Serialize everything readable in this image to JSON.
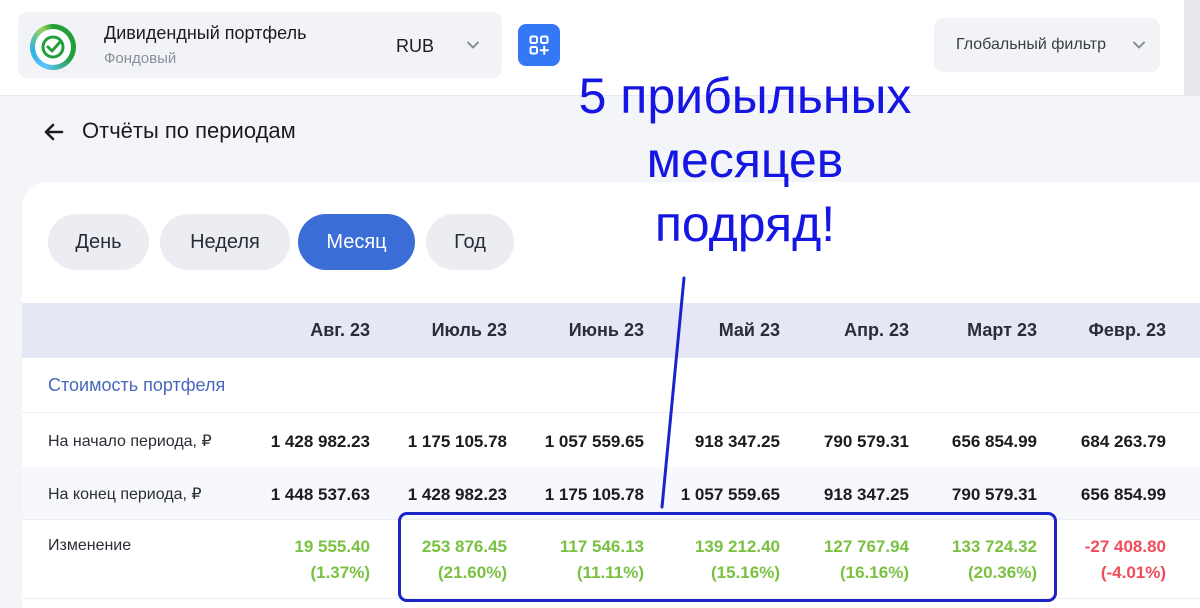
{
  "header": {
    "portfolio_name": "Дивидендный портфель",
    "portfolio_type": "Фондовый",
    "currency": "RUB",
    "global_filter": "Глобальный фильтр"
  },
  "page": {
    "title": "Отчёты по периодам"
  },
  "tabs": [
    {
      "label": "День",
      "active": false
    },
    {
      "label": "Неделя",
      "active": false
    },
    {
      "label": "Месяц",
      "active": true
    },
    {
      "label": "Год",
      "active": false
    }
  ],
  "table": {
    "columns": [
      "Авг. 23",
      "Июль 23",
      "Июнь 23",
      "Май 23",
      "Апр. 23",
      "Март 23",
      "Февр. 23"
    ],
    "section_label": "Стоимость портфеля",
    "rows": [
      {
        "label": "На начало периода, ₽",
        "values": [
          "1 428 982.23",
          "1 175 105.78",
          "1 057 559.65",
          "918 347.25",
          "790 579.31",
          "656 854.99",
          "684 263.79"
        ]
      },
      {
        "label": "На конец периода, ₽",
        "values": [
          "1 448 537.63",
          "1 428 982.23",
          "1 175 105.78",
          "1 057 559.65",
          "918 347.25",
          "790 579.31",
          "656 854.99"
        ]
      },
      {
        "label": "Изменение",
        "values": [
          "19 555.40",
          "253 876.45",
          "117 546.13",
          "139 212.40",
          "127 767.94",
          "133 724.32",
          "-27 408.80"
        ],
        "percents": [
          "(1.37%)",
          "(21.60%)",
          "(11.11%)",
          "(15.16%)",
          "(16.16%)",
          "(20.36%)",
          "(-4.01%)"
        ],
        "sign": [
          "pos",
          "pos",
          "pos",
          "pos",
          "pos",
          "pos",
          "neg"
        ]
      }
    ]
  },
  "annotation": {
    "lines": [
      "5 прибыльных",
      "месяцев",
      "подряд!"
    ]
  },
  "colors": {
    "accent": "#3a6ed6",
    "apps_button": "#3478f6",
    "positive": "#7ac142",
    "negative": "#ee4d5a",
    "annotation": "#1616e2"
  }
}
